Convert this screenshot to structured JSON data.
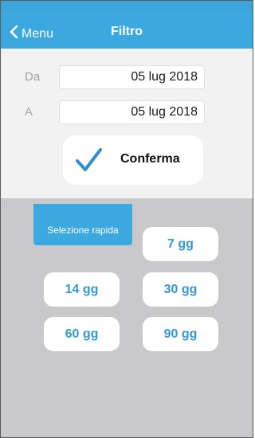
{
  "nav": {
    "back_label": "Menu",
    "title": "Filtro"
  },
  "filter": {
    "from_label": "Da",
    "from_value": "05 lug 2018",
    "to_label": "A",
    "to_value": "05 lug 2018",
    "confirm_label": "Conferma"
  },
  "quick": {
    "tab_label": "Selezione rapida",
    "options": [
      "7 gg",
      "14 gg",
      "30 gg",
      "60 gg",
      "90 gg"
    ]
  },
  "colors": {
    "accent": "#3ba9df",
    "background": "#c9c9cc",
    "check": "#2f8fd0"
  },
  "icons": {
    "back": "chevron-left-icon",
    "confirm": "checkmark-icon"
  }
}
